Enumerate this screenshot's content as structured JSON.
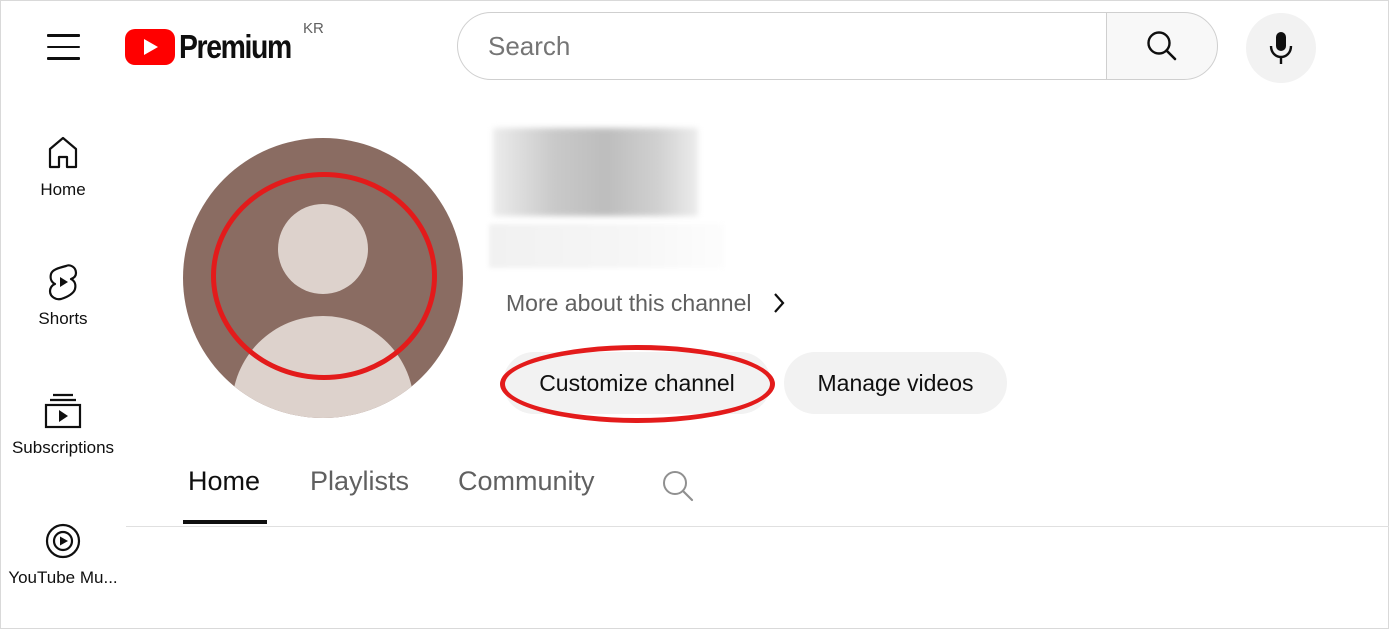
{
  "header": {
    "logo_text": "Premium",
    "region": "KR",
    "search_placeholder": "Search",
    "icons": [
      "menu-icon",
      "youtube-logo-icon",
      "search-icon",
      "mic-icon"
    ],
    "brand_color": "#ff0000"
  },
  "sidebar": {
    "items": [
      {
        "label": "Home",
        "icon": "home-icon"
      },
      {
        "label": "Shorts",
        "icon": "shorts-icon"
      },
      {
        "label": "Subscriptions",
        "icon": "subscriptions-icon"
      },
      {
        "label": "YouTube Mu..."
      }
    ]
  },
  "channel": {
    "more_about": "More about this channel",
    "customize_label": "Customize channel",
    "manage_label": "Manage videos",
    "annotation_color": "#e31b1b"
  },
  "tabs": [
    {
      "label": "Home",
      "active": true
    },
    {
      "label": "Playlists",
      "active": false
    },
    {
      "label": "Community",
      "active": false
    }
  ]
}
